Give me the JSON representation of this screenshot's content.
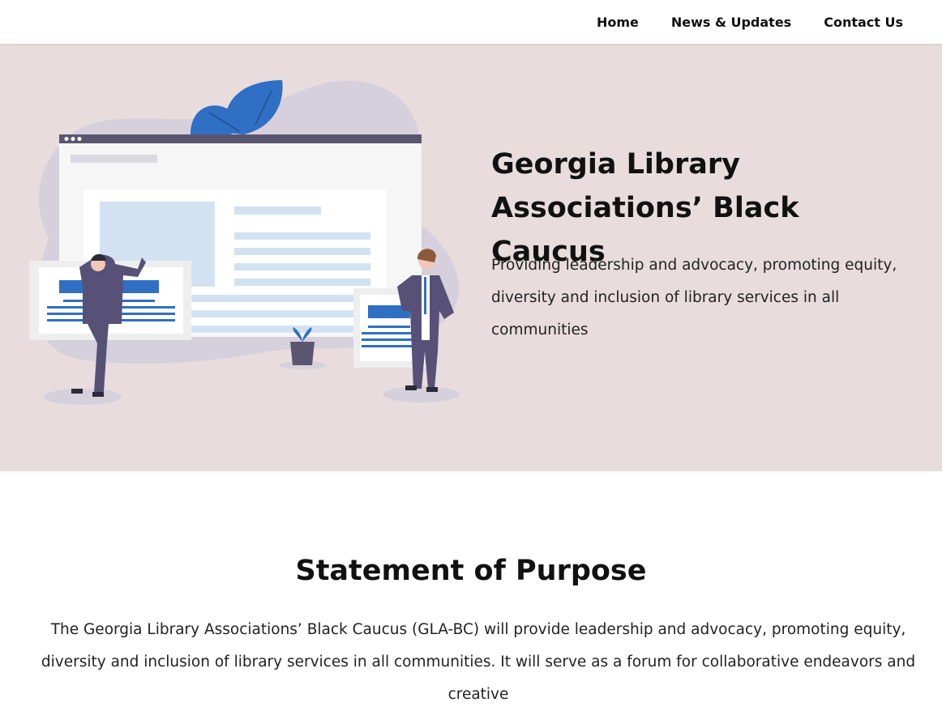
{
  "nav": {
    "items": [
      {
        "label": "Home"
      },
      {
        "label": "News & Updates"
      },
      {
        "label": "Contact Us"
      }
    ]
  },
  "hero": {
    "title": "Georgia Library Associations’ Black Caucus",
    "subtitle": "Providing leadership and advocacy, promoting equity, diversity and inclusion of library services in all communities",
    "illustration": "web-design-team-illustration"
  },
  "purpose": {
    "title": "Statement of Purpose",
    "text": "The Georgia Library Associations’ Black Caucus (GLA-BC) will provide leadership and advocacy, promoting equity, diversity and inclusion of library services in all communities. It will serve as a forum for collaborative endeavors and creative"
  },
  "colors": {
    "hero_bg": "#e8dcdd",
    "accent_blue": "#2f6fc4",
    "light_blue": "#d3e2f3",
    "browser_bar": "#5b5670",
    "blob": "#d6d0dc"
  }
}
